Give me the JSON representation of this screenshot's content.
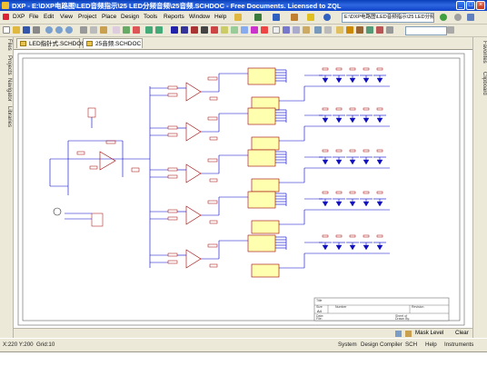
{
  "window": {
    "title": "DXP - E:\\DXP电路图\\LED音频指示\\25 LED分频音频\\25音频.SCHDOC - Free Documents. Licensed to ZQL"
  },
  "menubar": {
    "items": [
      "DXP",
      "File",
      "Edit",
      "View",
      "Project",
      "Place",
      "Design",
      "Tools",
      "Reports",
      "Window",
      "Help"
    ],
    "path_field": "E:\\DXP电路图\\LED音频指示\\25 LED分频"
  },
  "left_panel": {
    "tabs": [
      "Files",
      "Projects",
      "Navigator",
      "Libraries"
    ]
  },
  "right_panel": {
    "tabs": [
      "Favorites",
      "Clipboard"
    ]
  },
  "document_tabs": [
    "LED指针式.SCHDOC",
    "25音频.SCHDOC"
  ],
  "title_block": {
    "title_label": "Title",
    "size_label": "Size",
    "number_label": "Number",
    "revision_label": "Revision",
    "size_value": "A4",
    "date_label": "Date:",
    "file_label": "File:",
    "sheet_label": "Sheet of",
    "drawn_label": "Drawn By:"
  },
  "mask_bar": {
    "mask_level": "Mask Level",
    "clear": "Clear"
  },
  "status_bar": {
    "coords": "X:220 Y:200",
    "grid": "Grid:10",
    "buttons": [
      "System",
      "Design Compiler",
      "SCH",
      "Help",
      "Instruments"
    ]
  },
  "colors": {
    "title_bar": "#1043c9",
    "wire": "#0000c8",
    "component": "#a00000",
    "ic_fill": "#ffffb0",
    "led": "#1010c0",
    "sheet_bg": "#ffffff"
  }
}
